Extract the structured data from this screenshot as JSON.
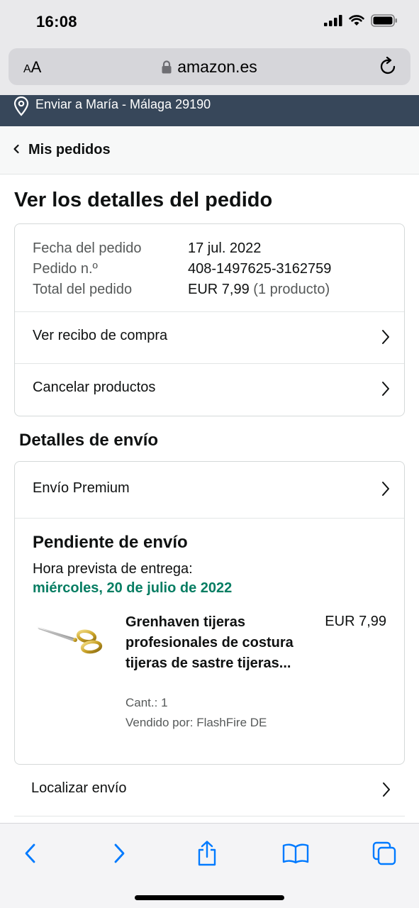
{
  "status_bar": {
    "time": "16:08"
  },
  "browser": {
    "text_size_label": "AA",
    "url": "amazon.es"
  },
  "header": {
    "deliver_to": "Enviar a María - Málaga 29190",
    "back_label": "Mis pedidos"
  },
  "page_title": "Ver los detalles del pedido",
  "order_summary": {
    "date_label": "Fecha del pedido",
    "date_value": "17 jul. 2022",
    "number_label": "Pedido n.º",
    "number_value": "408-1497625-3162759",
    "total_label": "Total del pedido",
    "total_value": "EUR 7,99",
    "total_note": "(1 producto)",
    "receipt_link": "Ver recibo de compra",
    "cancel_link": "Cancelar productos"
  },
  "shipping": {
    "section_title": "Detalles de envío",
    "method": "Envío Premium",
    "status": "Pendiente de envío",
    "eta_label": "Hora prevista de entrega:",
    "eta_date": "miércoles, 20 de julio de 2022",
    "eta_color": "#067d62",
    "product": {
      "title": "Grenhaven tijeras profesionales de costura tijeras de sastre tijeras...",
      "price": "EUR 7,99",
      "quantity": "Cant.: 1",
      "seller": "Vendido por: FlashFire DE",
      "image_icon": "scissors-icon"
    },
    "track_link": "Localizar envío"
  },
  "colors": {
    "header_bar": "#37475a",
    "link_text": "#0f1111",
    "muted_text": "#565959",
    "safari_blue": "#007aff"
  },
  "toolbar_icons": [
    "back-icon",
    "forward-icon",
    "share-icon",
    "bookmarks-icon",
    "tabs-icon"
  ]
}
